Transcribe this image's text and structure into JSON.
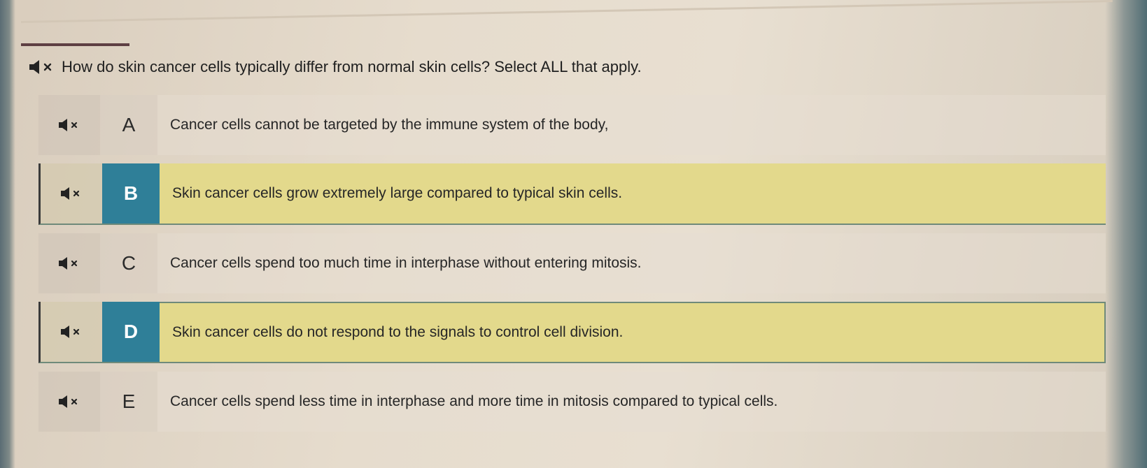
{
  "question": {
    "text": "How do skin cancer cells typically differ from normal skin cells? Select ALL that apply."
  },
  "choices": [
    {
      "letter": "A",
      "text": "Cancer cells cannot be targeted by the immune system of the body,",
      "selected": false
    },
    {
      "letter": "B",
      "text": "Skin cancer cells grow extremely large compared to typical skin cells.",
      "selected": true
    },
    {
      "letter": "C",
      "text": "Cancer cells spend too much time in interphase without entering mitosis.",
      "selected": false
    },
    {
      "letter": "D",
      "text": "Skin cancer cells do not respond to the signals to control cell division.",
      "selected": true
    },
    {
      "letter": "E",
      "text": "Cancer cells spend less time in interphase and more time in mitosis compared to typical cells.",
      "selected": false
    }
  ],
  "colors": {
    "selected_letter_bg": "#2f7f98",
    "selected_row_bg": "#e3d98c",
    "progress": "#5e3f43"
  },
  "icons": {
    "audio": "speaker-muted-icon"
  }
}
